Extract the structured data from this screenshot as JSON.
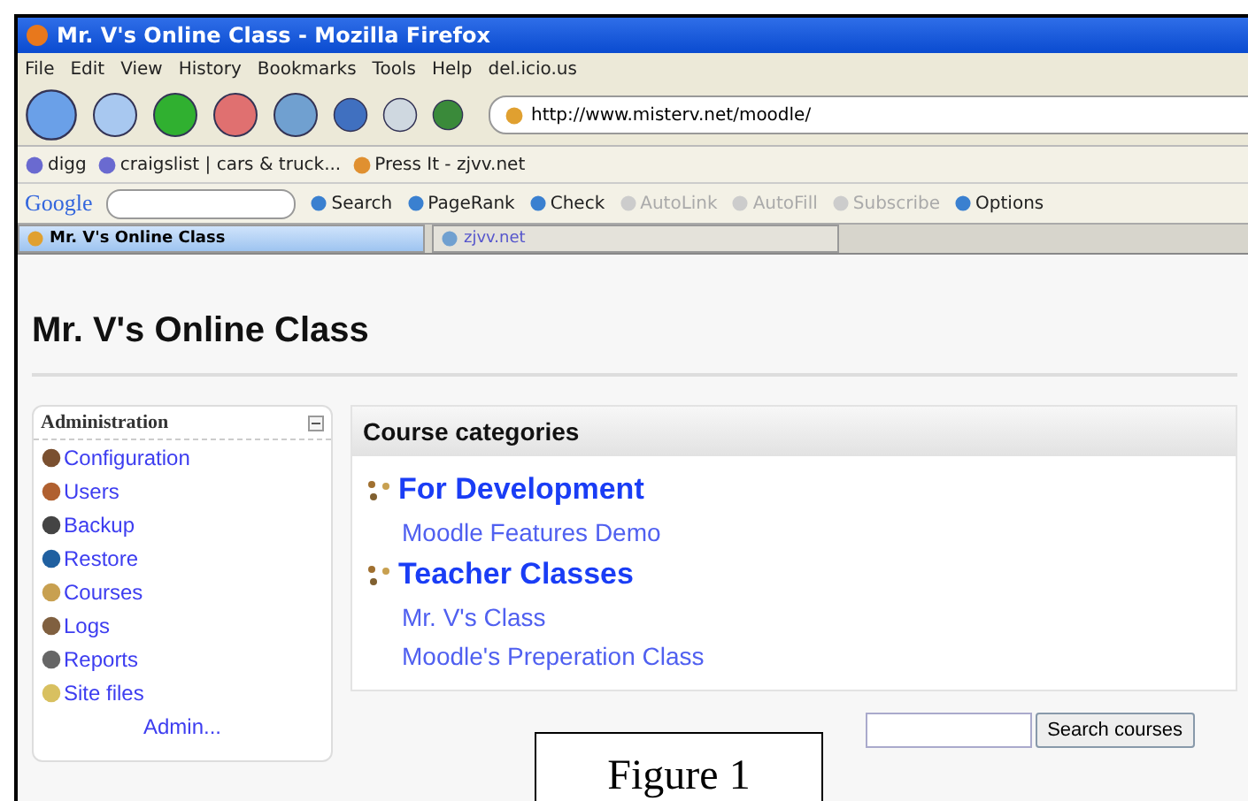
{
  "window": {
    "title": "Mr. V's Online Class - Mozilla Firefox"
  },
  "menu": [
    "File",
    "Edit",
    "View",
    "History",
    "Bookmarks",
    "Tools",
    "Help",
    "del.icio.us"
  ],
  "address": {
    "value": "http://www.misterv.net/moodle/"
  },
  "bookmarks": [
    "digg",
    "craigslist | cars & truck...",
    "Press It - zjvv.net"
  ],
  "google_toolbar": {
    "logo": "Google",
    "items": [
      {
        "label": "Search",
        "disabled": false
      },
      {
        "label": "PageRank",
        "disabled": false
      },
      {
        "label": "Check",
        "disabled": false
      },
      {
        "label": "AutoLink",
        "disabled": true
      },
      {
        "label": "AutoFill",
        "disabled": true
      },
      {
        "label": "Subscribe",
        "disabled": true
      },
      {
        "label": "Options",
        "disabled": false
      }
    ]
  },
  "tabs": [
    {
      "label": "Mr. V's Online Class",
      "selected": true
    },
    {
      "label": "zjvv.net",
      "selected": false
    }
  ],
  "page": {
    "title": "Mr. V's Online Class",
    "admin_block": {
      "title": "Administration",
      "items": [
        "Configuration",
        "Users",
        "Backup",
        "Restore",
        "Courses",
        "Logs",
        "Reports",
        "Site files"
      ],
      "more": "Admin..."
    },
    "categories": {
      "title": "Course categories",
      "groups": [
        {
          "name": "For Development",
          "courses": [
            "Moodle Features Demo"
          ]
        },
        {
          "name": "Teacher Classes",
          "courses": [
            "Mr. V's Class",
            "Moodle's Preperation Class"
          ]
        }
      ]
    },
    "search_button": "Search courses"
  },
  "caption": "Figure 1"
}
